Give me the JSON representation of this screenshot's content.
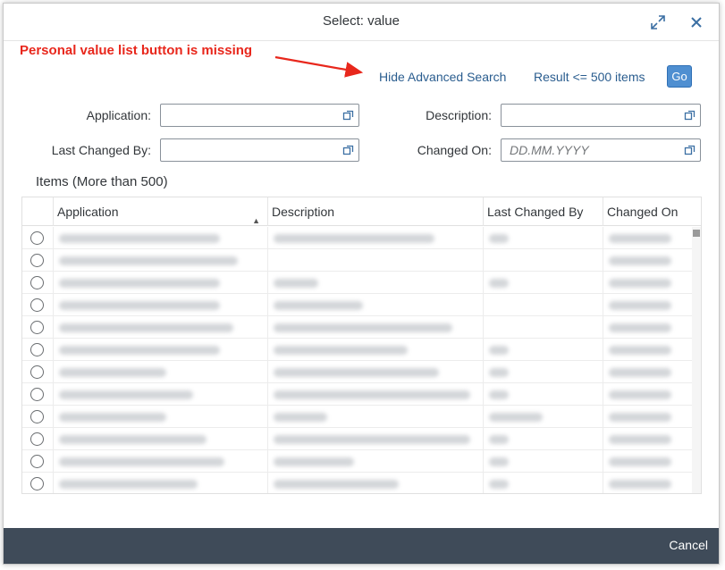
{
  "dialog": {
    "title": "Select: value",
    "annotation": "Personal value list button is missing",
    "annotation_color": "#e8271c"
  },
  "toolbar": {
    "hide_advanced_search": "Hide Advanced Search",
    "result_limit": "Result <= 500 items",
    "go_label": "Go"
  },
  "filters": {
    "application": {
      "label": "Application:",
      "value": ""
    },
    "description": {
      "label": "Description:",
      "value": ""
    },
    "last_changed_by": {
      "label": "Last Changed By:",
      "value": ""
    },
    "changed_on": {
      "label": "Changed On:",
      "value": "",
      "placeholder": "DD.MM.YYYY"
    }
  },
  "table": {
    "title": "Items (More than 500)",
    "columns": [
      "Application",
      "Description",
      "Last Changed By",
      "Changed On"
    ],
    "row_count_visible": 12
  },
  "footer": {
    "cancel_label": "Cancel"
  },
  "colors": {
    "accent": "#0a6ed1",
    "go_button": "#4f8fd1",
    "footer_bg": "#3f4b59"
  }
}
